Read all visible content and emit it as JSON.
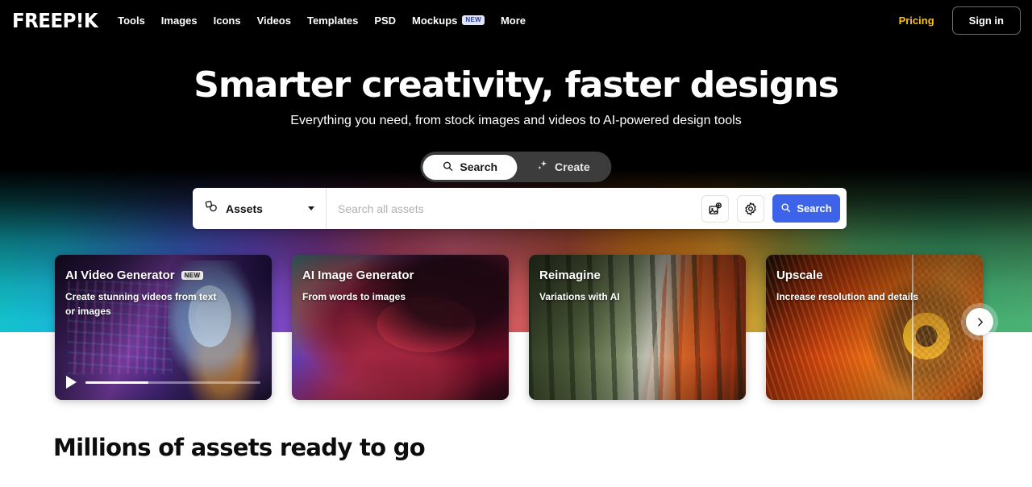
{
  "brand": {
    "logo": "FREEP!K",
    "accent_yellow": "#ffc107",
    "accent_blue": "#3d63e8"
  },
  "nav": {
    "items": [
      {
        "label": "Tools",
        "badge": ""
      },
      {
        "label": "Images",
        "badge": ""
      },
      {
        "label": "Icons",
        "badge": ""
      },
      {
        "label": "Videos",
        "badge": ""
      },
      {
        "label": "Templates",
        "badge": ""
      },
      {
        "label": "PSD",
        "badge": ""
      },
      {
        "label": "Mockups",
        "badge": "NEW"
      },
      {
        "label": "More",
        "badge": ""
      }
    ],
    "pricing": "Pricing",
    "signin": "Sign in"
  },
  "hero": {
    "title": "Smarter creativity, faster designs",
    "subtitle": "Everything you need, from stock images and videos to AI-powered design tools"
  },
  "mode_toggle": {
    "search_label": "Search",
    "create_label": "Create",
    "selected": "Search"
  },
  "search": {
    "category_value": "Assets",
    "placeholder": "Search all assets",
    "value": "",
    "submit_label": "Search"
  },
  "carousel": {
    "cards": [
      {
        "title": "AI Video Generator",
        "badge": "NEW",
        "subtitle": "Create stunning videos from text or images",
        "has_video_controls": true,
        "progress_percent": 36
      },
      {
        "title": "AI Image Generator",
        "badge": "",
        "subtitle": "From words to images",
        "has_video_controls": false,
        "progress_percent": 0
      },
      {
        "title": "Reimagine",
        "badge": "",
        "subtitle": "Variations with AI",
        "has_video_controls": false,
        "progress_percent": 0
      },
      {
        "title": "Upscale",
        "badge": "",
        "subtitle": "Increase resolution and details",
        "has_video_controls": false,
        "progress_percent": 0
      }
    ]
  },
  "section": {
    "assets_heading": "Millions of assets ready to go"
  }
}
